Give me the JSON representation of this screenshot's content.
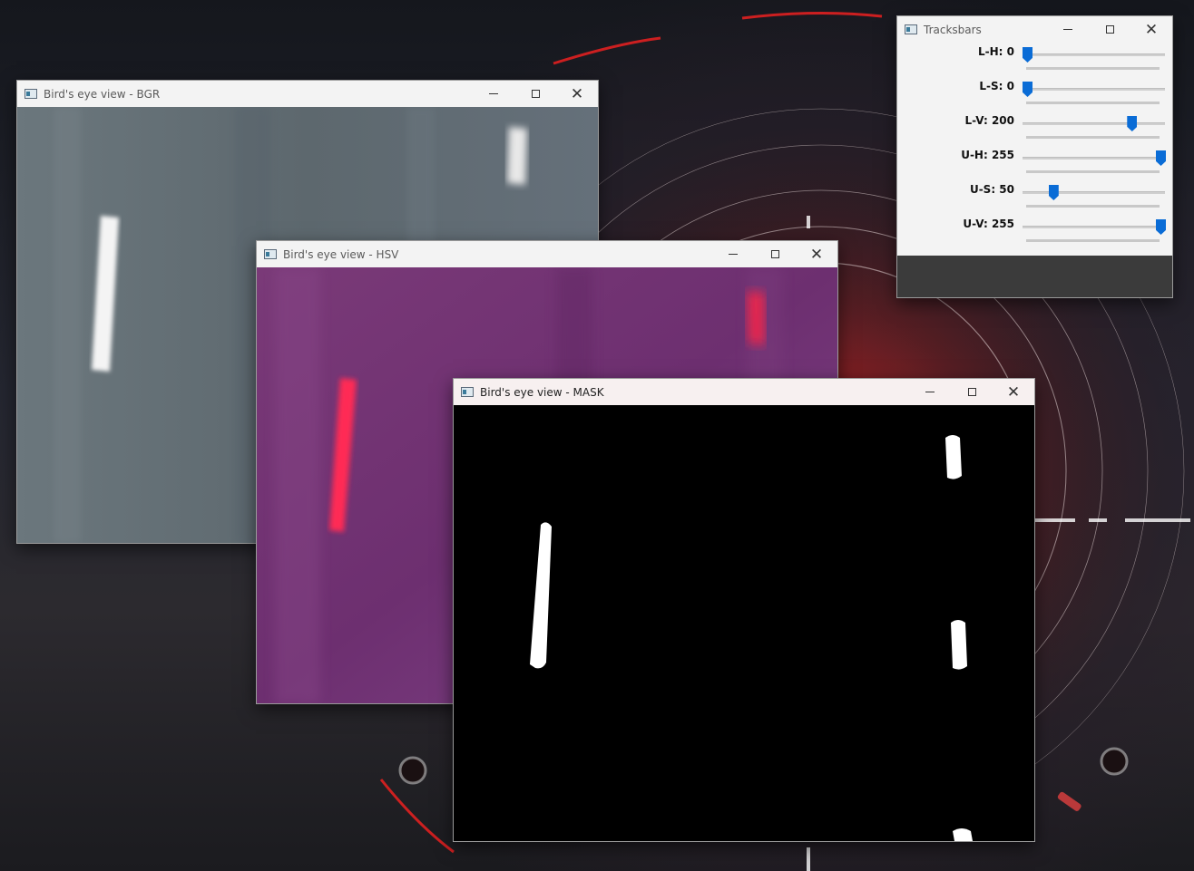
{
  "windows": {
    "bgr": {
      "title": "Bird's eye view - BGR"
    },
    "hsv": {
      "title": "Bird's eye view - HSV"
    },
    "mask": {
      "title": "Bird's eye view - MASK"
    },
    "trackbars": {
      "title": "Tracksbars",
      "sliders": [
        {
          "label": "L-H: 0",
          "value": 0,
          "max": 255
        },
        {
          "label": "L-S: 0",
          "value": 0,
          "max": 255
        },
        {
          "label": "L-V: 200",
          "value": 200,
          "max": 255
        },
        {
          "label": "U-H: 255",
          "value": 255,
          "max": 255
        },
        {
          "label": "U-S: 50",
          "value": 50,
          "max": 255
        },
        {
          "label": "U-V: 255",
          "value": 255,
          "max": 255
        }
      ]
    }
  },
  "window_controls": {
    "minimize": "minimize-icon",
    "maximize": "maximize-icon",
    "close": "close-icon"
  },
  "colors": {
    "bgr_bg": "#667177",
    "hsv_bg": "#6e3070",
    "mask_bg": "#000000",
    "slider_thumb": "#0a6cd6",
    "lane_hsv": "#ff2a55"
  }
}
